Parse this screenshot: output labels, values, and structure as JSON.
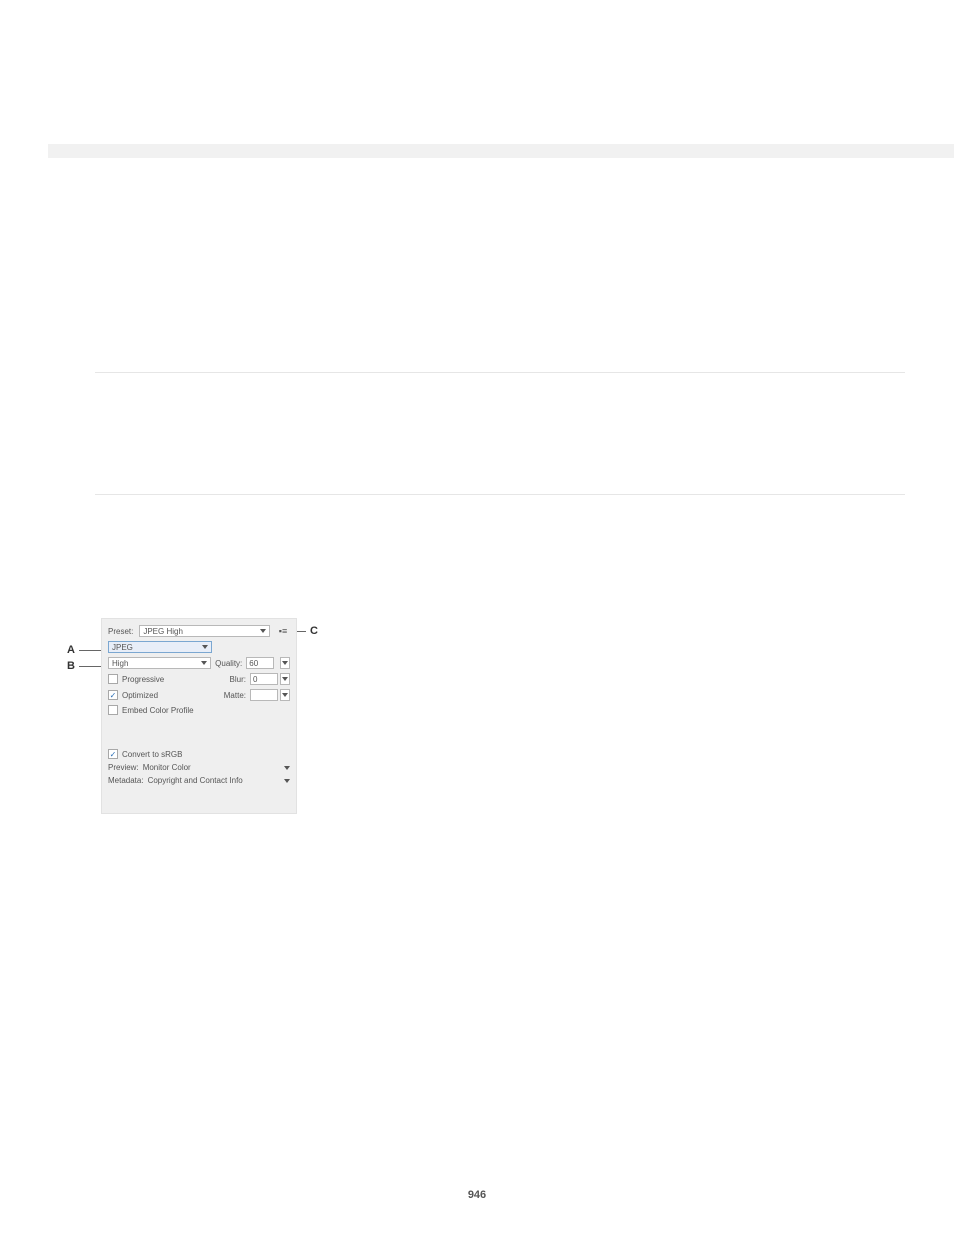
{
  "dialog": {
    "presetLabel": "Preset:",
    "presetValue": "JPEG High",
    "format": "JPEG",
    "quality": "High",
    "qualityLabel": "Quality:",
    "qualityValue": "60",
    "progressive": "Progressive",
    "optimized": "Optimized",
    "blurLabel": "Blur:",
    "blurValue": "0",
    "matteLabel": "Matte:",
    "embedColor": "Embed Color Profile",
    "convertSrgb": "Convert to sRGB",
    "previewLabel": "Preview:",
    "previewValue": "Monitor Color",
    "metadataLabel": "Metadata:",
    "metadataValue": "Copyright and Contact Info"
  },
  "callouts": {
    "a": "A",
    "b": "B",
    "c": "C"
  },
  "pageNumber": "946"
}
